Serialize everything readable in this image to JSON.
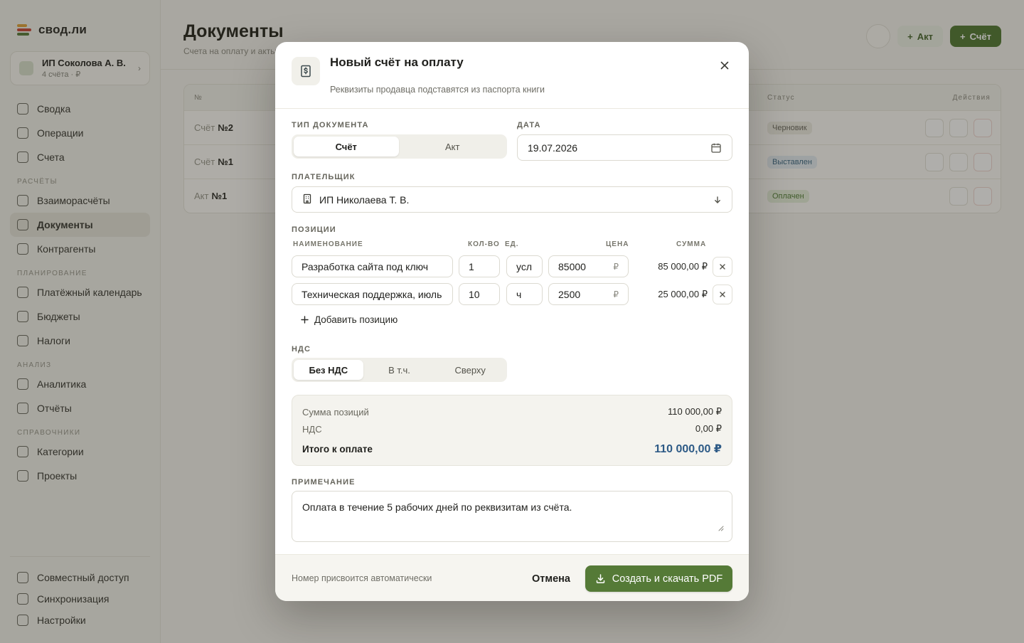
{
  "app": {
    "logo_text": "свод.ли",
    "org_name": "ИП Соколова А. В.",
    "org_sub": "4 счёта · ₽"
  },
  "sidebar": {
    "top": [
      "Сводка",
      "Операции",
      "Счета"
    ],
    "sections": [
      {
        "title": "Расчёты",
        "items": [
          "Взаиморасчёты",
          "Документы",
          "Контрагенты"
        ]
      },
      {
        "title": "Планирование",
        "items": [
          "Платёжный календарь",
          "Бюджеты",
          "Налоги"
        ]
      },
      {
        "title": "Анализ",
        "items": [
          "Аналитика",
          "Отчёты"
        ]
      },
      {
        "title": "Справочники",
        "items": [
          "Категории",
          "Проекты"
        ]
      }
    ],
    "bottom": [
      "Совместный доступ",
      "Синхронизация",
      "Настройки"
    ],
    "active": "Документы"
  },
  "page": {
    "title": "Документы",
    "subtitle": "Счета на оплату и акты",
    "btn_act": "Акт",
    "btn_invoice": "Счёт",
    "col_number": "№",
    "col_status": "Статус",
    "col_actions": "Действия",
    "rows": [
      {
        "kind": "Счёт",
        "num": "№2",
        "status": "Черновик"
      },
      {
        "kind": "Счёт",
        "num": "№1",
        "status": "Выставлен"
      },
      {
        "kind": "Акт",
        "num": "№1",
        "status": "Оплачен"
      }
    ]
  },
  "modal": {
    "title": "Новый счёт на оплату",
    "subtitle": "Реквизиты продавца подставятся из паспорта книги",
    "doc_type_label": "Тип документа",
    "doc_types": [
      "Счёт",
      "Акт"
    ],
    "doc_type_selected": "Счёт",
    "date_label": "Дата",
    "date_value": "19.07.2026",
    "payer_label": "Плательщик",
    "payer_value": "ИП Николаева Т. В.",
    "items_label": "Позиции",
    "columns": {
      "name": "Наименование",
      "qty": "Кол-во",
      "unit": "Ед.",
      "price": "Цена",
      "sum": "Сумма"
    },
    "currency": "₽",
    "lines": [
      {
        "name": "Разработка сайта под ключ",
        "qty": "1",
        "unit": "усл",
        "price": "85000",
        "sum": "85 000,00 ₽"
      },
      {
        "name": "Техническая поддержка, июль",
        "qty": "10",
        "unit": "ч",
        "price": "2500",
        "sum": "25 000,00 ₽"
      }
    ],
    "add_line": "Добавить позицию",
    "vat_label": "НДС",
    "vat_options": [
      "Без НДС",
      "В т.ч.",
      "Сверху"
    ],
    "vat_selected": "Без НДС",
    "totals": {
      "items_label": "Сумма позиций",
      "items_value": "110 000,00 ₽",
      "vat_label": "НДС",
      "vat_value": "0,00 ₽",
      "total_label": "Итого к оплате",
      "total_value": "110 000,00 ₽"
    },
    "note_label": "Примечание",
    "note_value": "Оплата в течение 5 рабочих дней по реквизитам из счёта.",
    "footer_hint": "Номер присвоится автоматически",
    "cancel": "Отмена",
    "submit": "Создать и скачать PDF"
  },
  "colors": {
    "accent": "#557a37",
    "total": "#2d5a86"
  }
}
